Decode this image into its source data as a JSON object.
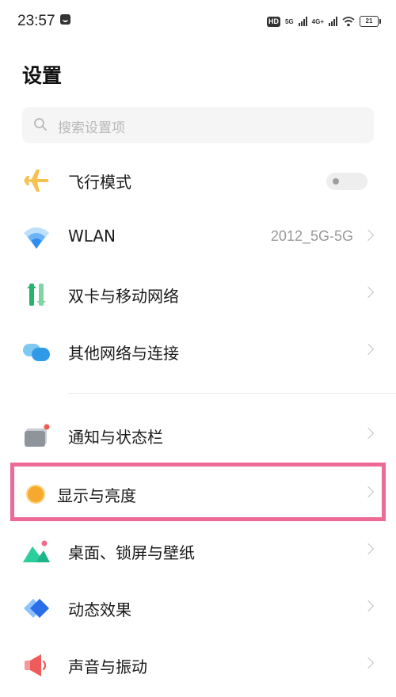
{
  "status_bar": {
    "time": "23:57",
    "hd_label": "HD",
    "sim1_network": "5G",
    "sim2_network": "4G+",
    "battery": "21"
  },
  "title": "设置",
  "search": {
    "placeholder": "搜索设置项"
  },
  "items": [
    {
      "label": "飞行模式",
      "icon": "airplane-icon",
      "control": "toggle",
      "toggle_on": false
    },
    {
      "label": "WLAN",
      "icon": "wifi-icon",
      "value": "2012_5G-5G",
      "control": "chevron"
    },
    {
      "label": "双卡与移动网络",
      "icon": "dual-sim-icon",
      "control": "chevron"
    },
    {
      "label": "其他网络与连接",
      "icon": "cloud-link-icon",
      "control": "chevron"
    },
    {
      "label": "通知与状态栏",
      "icon": "notification-icon",
      "control": "chevron"
    },
    {
      "label": "显示与亮度",
      "icon": "brightness-icon",
      "control": "chevron",
      "highlighted": true
    },
    {
      "label": "桌面、锁屏与壁纸",
      "icon": "wallpaper-icon",
      "control": "chevron"
    },
    {
      "label": "动态效果",
      "icon": "motion-effects-icon",
      "control": "chevron"
    },
    {
      "label": "声音与振动",
      "icon": "speaker-icon",
      "control": "chevron"
    }
  ],
  "colors": {
    "highlight_border": "#ec6a94",
    "airplane": "#f6c14e",
    "wifi": "#2f8cf0",
    "dual_sim": "#26b36b",
    "brightness": "#f7a82f",
    "speaker": "#ef5a5a"
  }
}
